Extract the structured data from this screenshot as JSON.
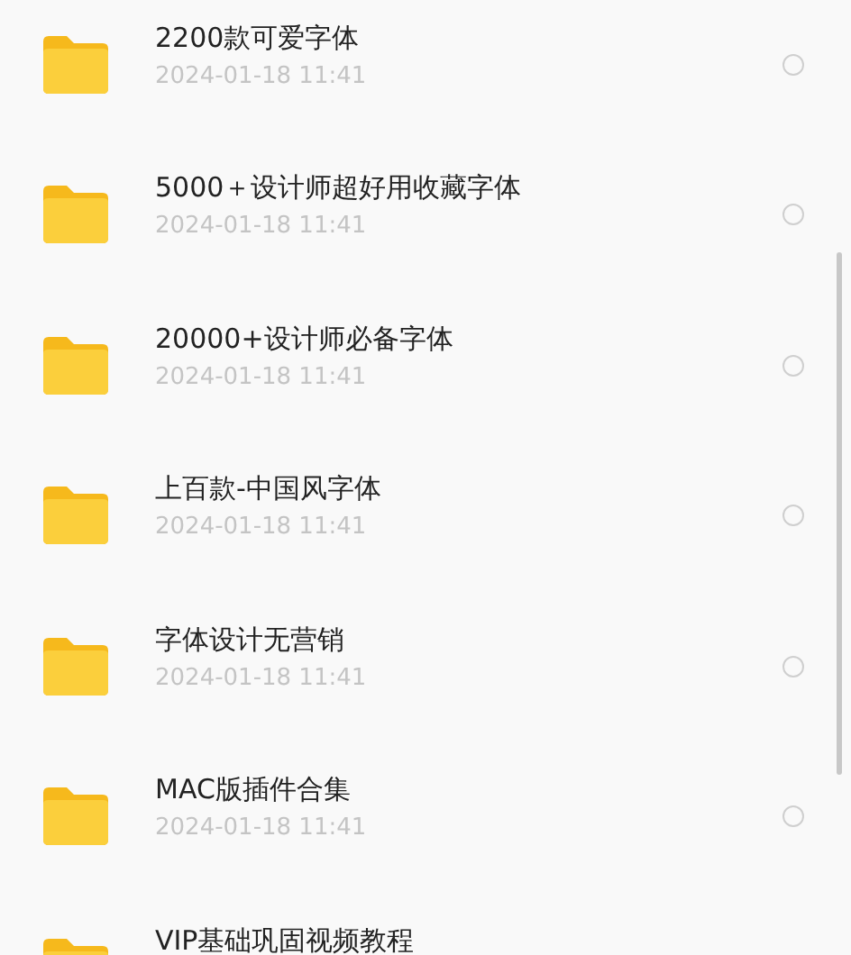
{
  "files": [
    {
      "name": "2200款可爱字体",
      "date": "2024-01-18 11:41",
      "selected": false
    },
    {
      "name": "5000＋设计师超好用收藏字体",
      "date": "2024-01-18 11:41",
      "selected": false
    },
    {
      "name": "20000+设计师必备字体",
      "date": "2024-01-18 11:41",
      "selected": false
    },
    {
      "name": "上百款-中国风字体",
      "date": "2024-01-18 11:41",
      "selected": false
    },
    {
      "name": "字体设计无营销",
      "date": "2024-01-18 11:41",
      "selected": false
    },
    {
      "name": "MAC版插件合集",
      "date": "2024-01-18 11:41",
      "selected": false
    },
    {
      "name": "VIP基础巩固视频教程"
    }
  ]
}
